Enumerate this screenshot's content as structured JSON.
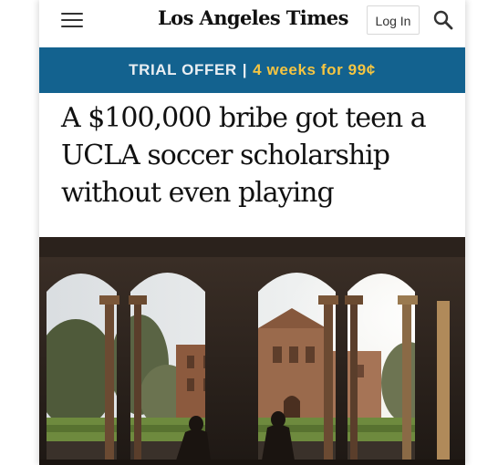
{
  "header": {
    "menu_icon": "hamburger-menu-icon",
    "brand": "Los Angeles Times",
    "login_label": "Log In",
    "search_icon": "search-icon"
  },
  "trial_banner": {
    "prefix": "TRIAL OFFER",
    "separator": "|",
    "offer": "4 weeks for 99¢",
    "background_color": "#13628f",
    "offer_color": "#f5c542"
  },
  "article": {
    "headline": "A $100,000 bribe got teen a UCLA soccer scholarship without even playing"
  },
  "hero_image": {
    "description_icon": "campus-arches-photo"
  }
}
